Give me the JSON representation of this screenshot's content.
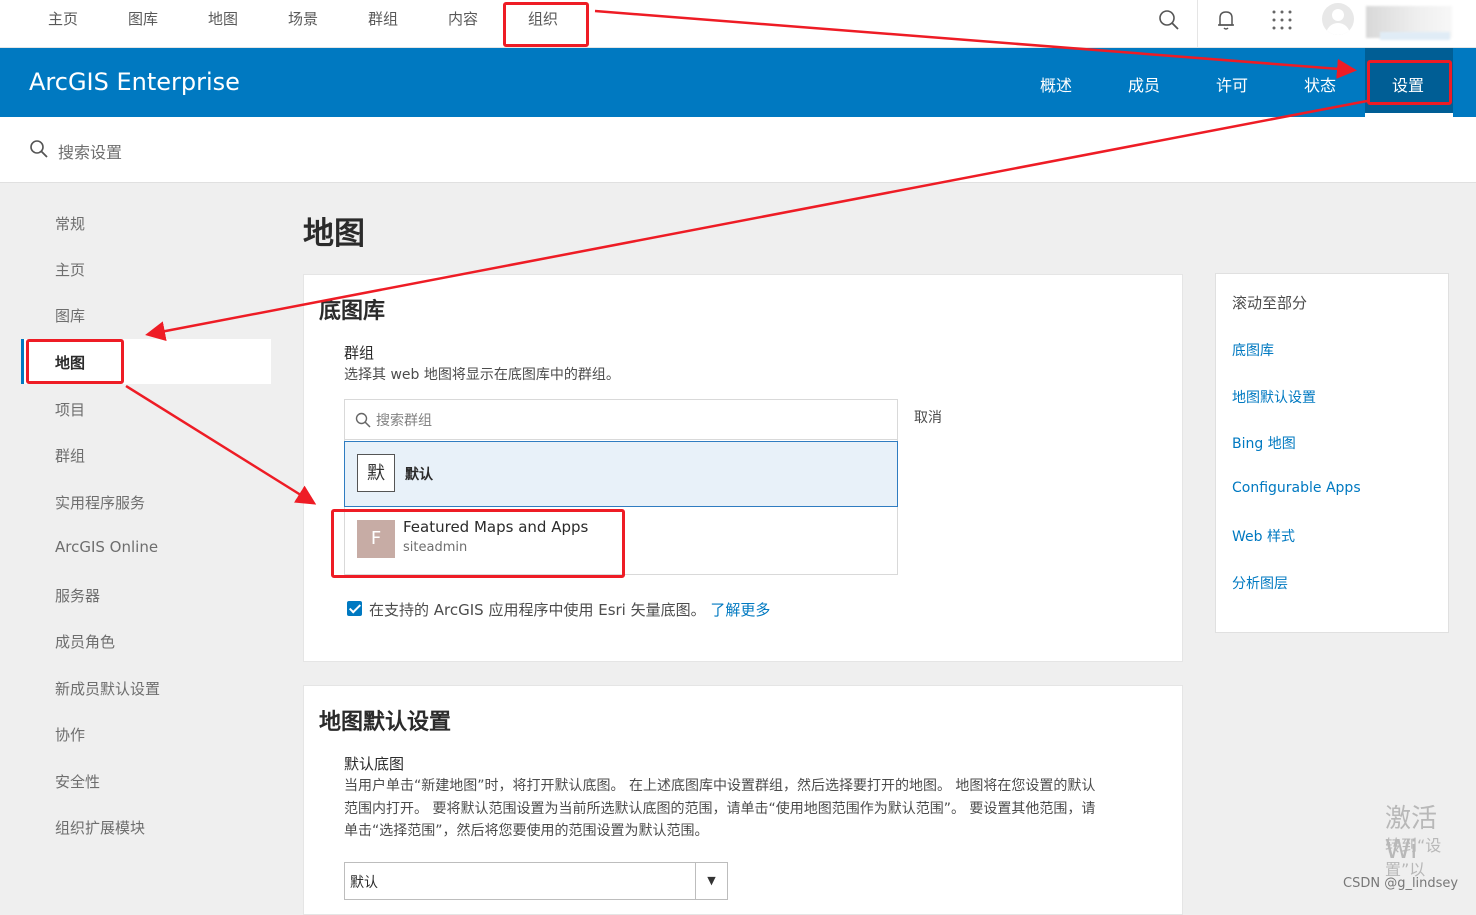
{
  "topnav": {
    "items": [
      "主页",
      "图库",
      "地图",
      "场景",
      "群组",
      "内容",
      "组织"
    ],
    "icons": [
      "search-icon",
      "bell-icon",
      "app-launcher-icon"
    ]
  },
  "banner": {
    "title": "ArcGIS Enterprise",
    "tabs": [
      "概述",
      "成员",
      "许可",
      "状态",
      "设置"
    ],
    "active_tab": "设置"
  },
  "settings_search": {
    "placeholder": "搜索设置"
  },
  "sidebar": {
    "items": [
      "常规",
      "主页",
      "图库",
      "地图",
      "项目",
      "群组",
      "实用程序服务",
      "ArcGIS Online",
      "服务器",
      "成员角色",
      "新成员默认设置",
      "协作",
      "安全性",
      "组织扩展模块"
    ],
    "active": "地图"
  },
  "page_title": "地图",
  "basemap_gallery": {
    "heading": "底图库",
    "group_label": "群组",
    "group_desc": "选择其 web 地图将显示在底图库中的群组。",
    "search_placeholder": "搜索群组",
    "cancel": "取消",
    "groups": [
      {
        "thumb": "默",
        "name": "默认",
        "owner": ""
      },
      {
        "thumb": "F",
        "name": "Featured Maps and Apps",
        "owner": "siteadmin"
      }
    ],
    "vector_checkbox": "在支持的 ArcGIS 应用程序中使用 Esri 矢量底图。",
    "learn_more": "了解更多"
  },
  "map_defaults": {
    "heading": "地图默认设置",
    "label": "默认底图",
    "desc": [
      "当用户单击“新建地图”时，将打开默认底图。 在上述底图库中设置群组，然后选择要打开的地图。 地图将在您设置的默认",
      "范围内打开。 要将默认范围设置为当前所选默认底图的范围，请单击“使用地图范围作为默认范围”。 要设置其他范围，请",
      "单击“选择范围”，然后将您要使用的范围设置为默认范围。"
    ],
    "select_value": "默认",
    "select_arrow": "▼"
  },
  "scroll_nav": {
    "heading": "滚动至部分",
    "links": [
      "底图库",
      "地图默认设置",
      "Bing 地图",
      "Configurable Apps",
      "Web 样式",
      "分析图层"
    ]
  },
  "watermark": {
    "line1": "激活 Wi",
    "line2": "转到“设置”以"
  },
  "credit": "CSDN @g_lindsey",
  "colors": {
    "brand": "#0079c1",
    "annotation": "#ee1c25"
  }
}
